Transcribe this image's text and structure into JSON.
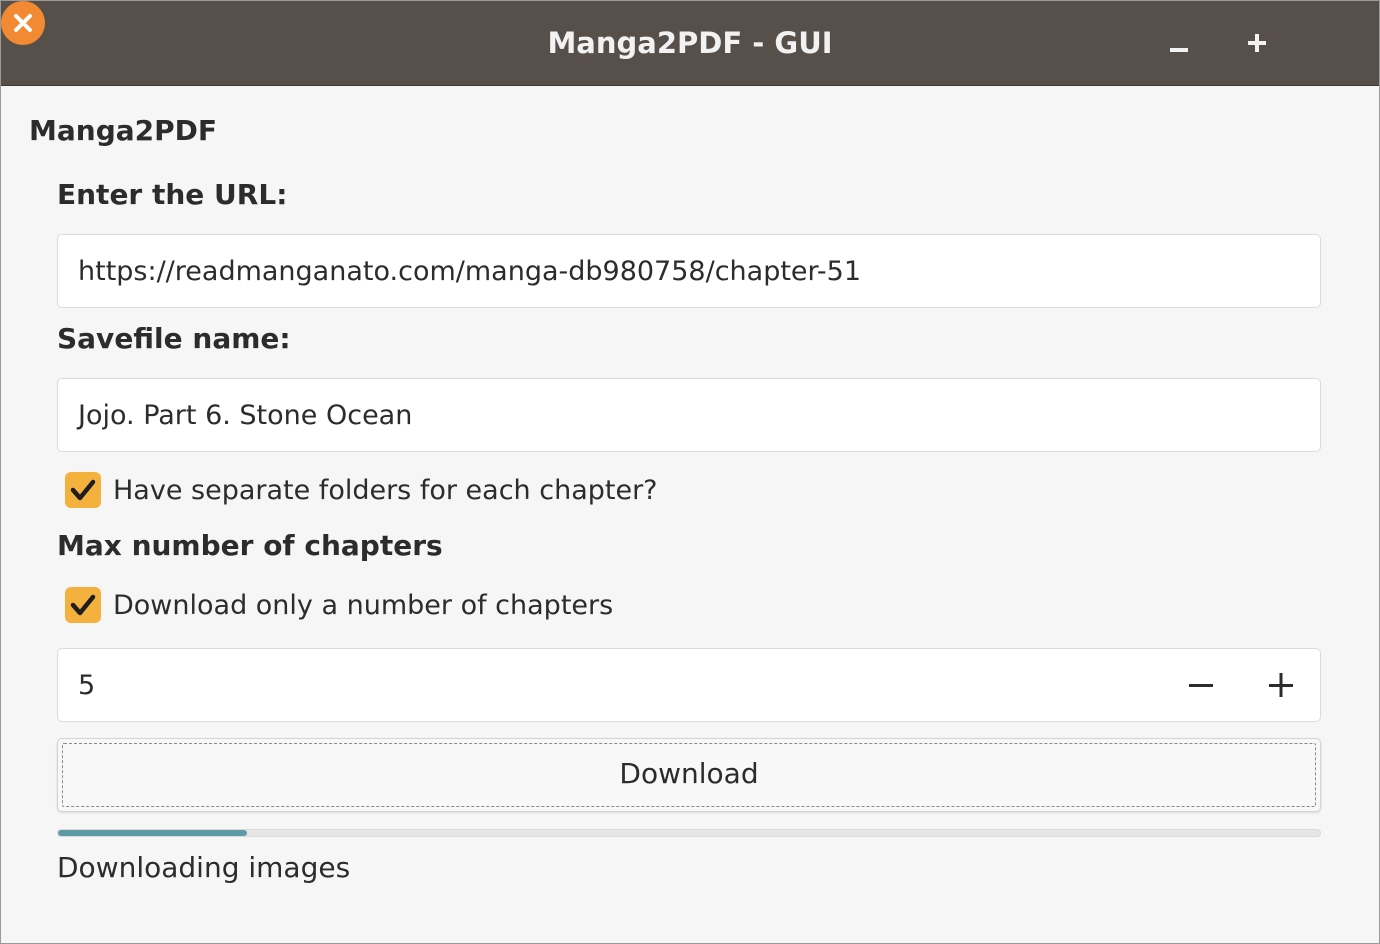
{
  "window": {
    "title": "Manga2PDF - GUI",
    "buttons": {
      "minimize": "minimize-icon",
      "maximize": "maximize-icon",
      "close": "close-icon"
    },
    "colors": {
      "titlebar": "#574f4a",
      "close": "#f28a33",
      "checkbox": "#f5b13d",
      "progress": "#5e9aa5"
    }
  },
  "app": {
    "heading": "Manga2PDF"
  },
  "url": {
    "label": "Enter the URL:",
    "value": "https://readmanganato.com/manga-db980758/chapter-51"
  },
  "savefile": {
    "label": "Savefile name:",
    "value": "Jojo. Part 6. Stone Ocean"
  },
  "separate_folders": {
    "label": "Have separate folders for each chapter?",
    "checked": true
  },
  "max_chapters": {
    "label": "Max number of chapters",
    "limit_label": "Download only a number of chapters",
    "limit_checked": true,
    "value": "5"
  },
  "download": {
    "label": "Download"
  },
  "progress": {
    "fraction": 0.15,
    "status": "Downloading images"
  }
}
